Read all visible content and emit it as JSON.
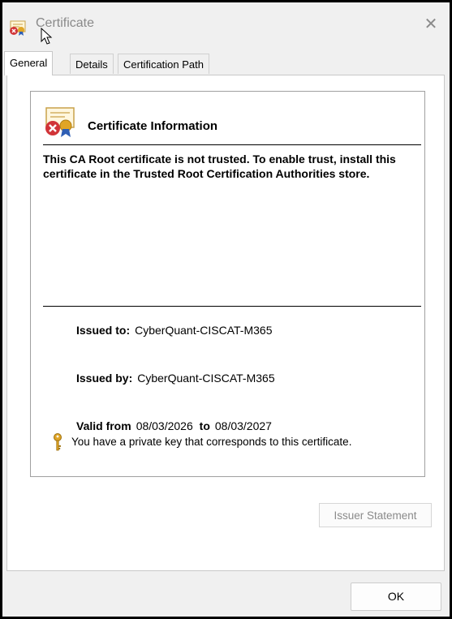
{
  "window": {
    "title": "Certificate",
    "close_glyph": "✕"
  },
  "tabs": [
    {
      "label": "General",
      "active": true
    },
    {
      "label": "Details",
      "active": false
    },
    {
      "label": "Certification Path",
      "active": false
    }
  ],
  "general": {
    "heading": "Certificate Information",
    "warning": "This CA Root certificate is not trusted. To enable trust, install this certificate in the Trusted Root Certification Authorities store.",
    "issued_to_label": "Issued to:",
    "issued_to_value": "CyberQuant-CISCAT-M365",
    "issued_by_label": "Issued by:",
    "issued_by_value": "CyberQuant-CISCAT-M365",
    "valid_from_label": "Valid from",
    "valid_from_value": "08/03/2026",
    "valid_to_label": "to",
    "valid_to_value": "08/03/2027",
    "private_key_note": "You have a private key that corresponds to this certificate.",
    "issuer_statement_button": "Issuer Statement"
  },
  "footer": {
    "ok_button": "OK"
  },
  "icons": {
    "title": "certificate-error-icon",
    "info": "certificate-error-icon",
    "key": "key-icon",
    "close": "close-icon"
  },
  "colors": {
    "dialog_bg": "#f0f0f0",
    "disabled_text": "#8a8a8a",
    "error_red": "#d13438",
    "ribbon_blue": "#2f5fb5",
    "seal_gold": "#e0a526"
  }
}
